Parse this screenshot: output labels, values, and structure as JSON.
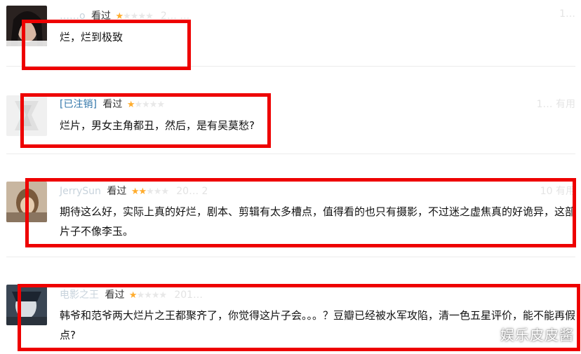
{
  "reviews": [
    {
      "username": "……o",
      "watched": "看过",
      "stars_on": "★",
      "stars_off": "★★★★",
      "date": "2… …",
      "useful": "1…",
      "text": "烂，烂到极致"
    },
    {
      "username": "[已注销]",
      "watched": "看过",
      "stars_on": "★",
      "stars_off": "★★★★",
      "date": "",
      "useful": "1… 有用",
      "text": "烂片，男女主角都丑，然后，是有吴莫愁?"
    },
    {
      "username": "JerrySun",
      "watched": "看过",
      "stars_on": "★★",
      "stars_off": "★★★",
      "date": "20… 2",
      "useful": "10 有用",
      "text": "期待这么好，实际上真的好烂，剧本、剪辑有太多槽点，值得看的也只有摄影，不过迷之虚焦真的好诡异，这部片子不像李玉。"
    },
    {
      "username": "电影之王",
      "watched": "看过",
      "stars_on": "★",
      "stars_off": "★★★★",
      "date": "201…",
      "useful": "",
      "text": "韩爷和范爷两大烂片之王都聚齐了，你觉得这片子会。。。？豆瓣已经被水军攻陷，清一色五星评价，能不能再假点?"
    }
  ],
  "watermark": "娱乐皮皮酱",
  "colors": {
    "highlight": "#ee0000",
    "star_on": "#ffac2d",
    "link": "#3377aa"
  }
}
